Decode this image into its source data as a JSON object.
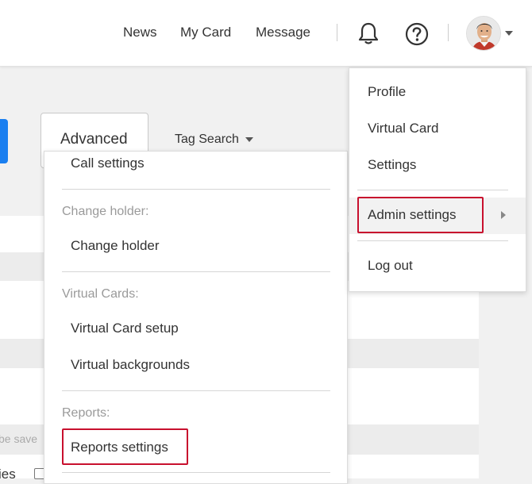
{
  "header": {
    "nav": [
      "News",
      "My Card",
      "Message"
    ],
    "icons": [
      "bell-icon",
      "help-icon"
    ],
    "avatar": "user-avatar"
  },
  "toolbar": {
    "advanced_label": "Advanced",
    "tag_search_label": "Tag Search"
  },
  "background_fragments": {
    "saved_fragment": "be save",
    "label_fragment": "ies"
  },
  "settings_menu": {
    "call_settings": "Call settings",
    "change_holder_heading": "Change holder:",
    "change_holder": "Change holder",
    "virtual_cards_heading": "Virtual Cards:",
    "virtual_card_setup": "Virtual Card setup",
    "virtual_backgrounds": "Virtual backgrounds",
    "reports_heading": "Reports:",
    "reports_settings": "Reports settings"
  },
  "user_menu": {
    "profile": "Profile",
    "virtual_card": "Virtual Card",
    "settings": "Settings",
    "admin_settings": "Admin settings",
    "log_out": "Log out"
  },
  "colors": {
    "highlight": "#c8102e",
    "primary_blue": "#1a7ff0"
  }
}
